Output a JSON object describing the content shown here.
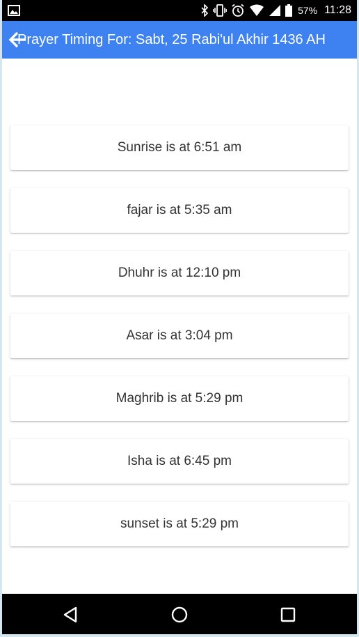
{
  "status_bar": {
    "battery_percent": "57%",
    "time": "11:28",
    "icons": [
      "image-icon",
      "bluetooth-icon",
      "vibrate-icon",
      "alarm-icon",
      "wifi-icon",
      "signal-icon",
      "battery-icon"
    ]
  },
  "app_bar": {
    "back_icon": "arrow-left-icon",
    "title": "Prayer Timing For: Sabt, 25 Rabi'ul Akhir 1436 AH"
  },
  "timings": [
    "Sunrise is at 6:51 am",
    "fajar is at 5:35 am",
    "Dhuhr is at 12:10 pm",
    "Asar is at 3:04 pm",
    "Maghrib is at 5:29 pm",
    "Isha is at 6:45 pm",
    "sunset is at 5:29 pm"
  ],
  "nav_bar": {
    "icons": [
      "back-triangle-icon",
      "home-circle-icon",
      "recents-square-icon"
    ]
  },
  "colors": {
    "app_bar": "#3d82f0",
    "status_bar": "#000000",
    "nav_bar": "#000000",
    "card_text": "#333333"
  }
}
